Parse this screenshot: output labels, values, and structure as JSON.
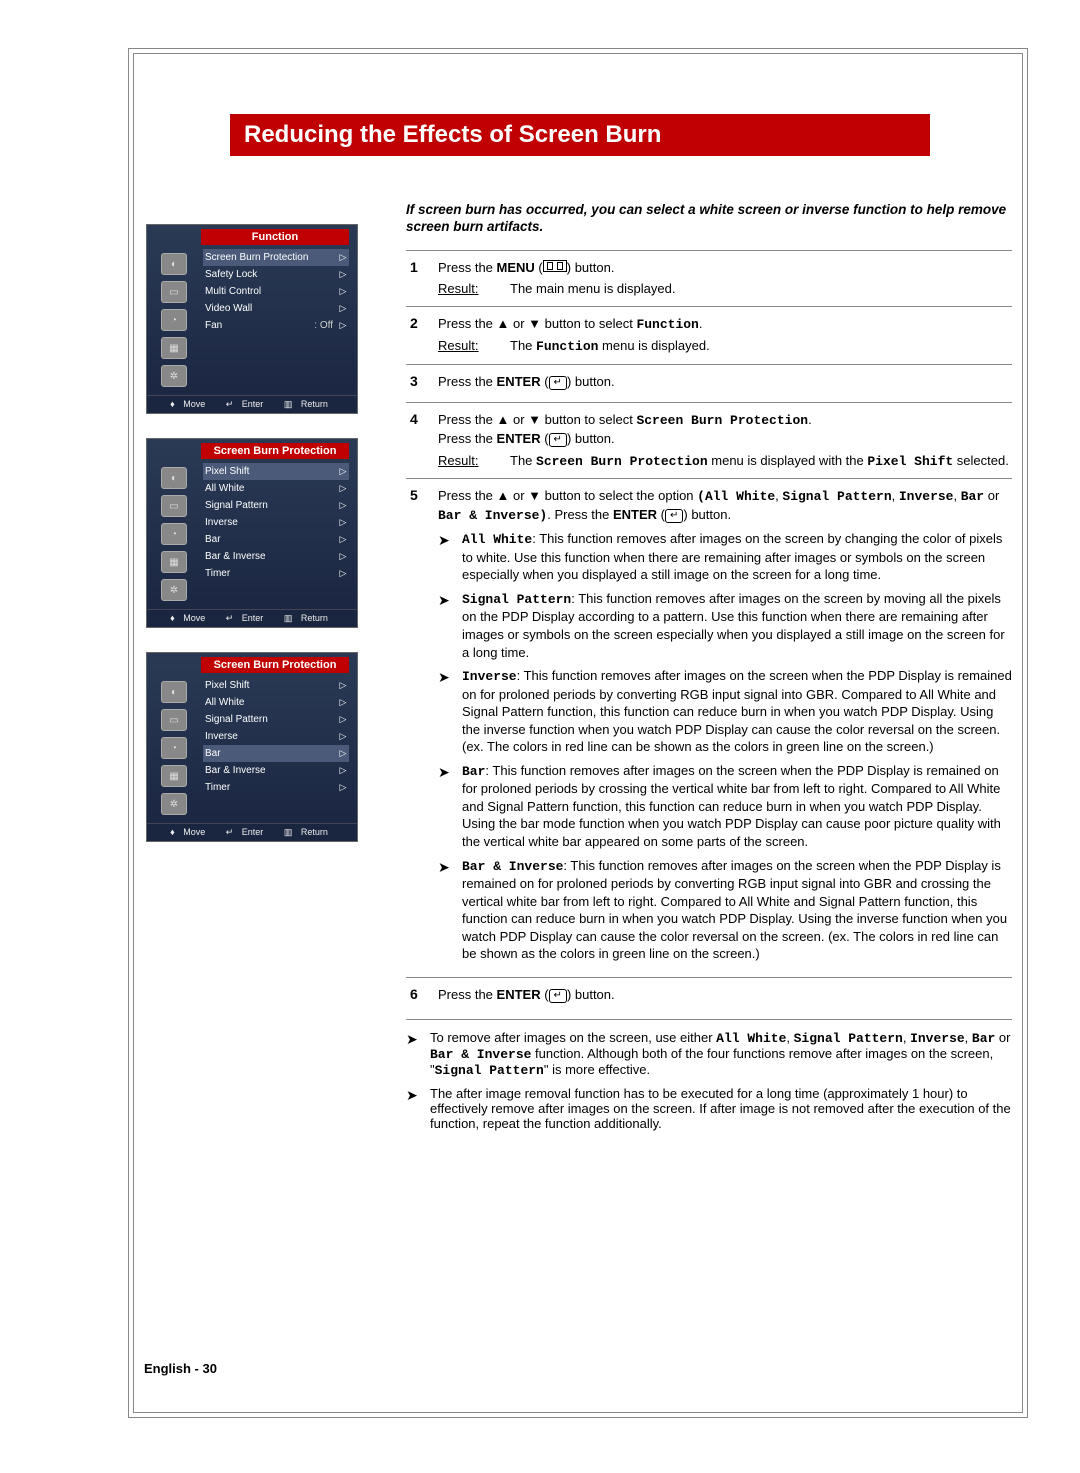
{
  "title": "Reducing the Effects of Screen Burn",
  "intro": "If screen burn has occurred, you can select a white screen or inverse function to help remove screen burn artifacts.",
  "page_label": "English - 30",
  "osd_footer": {
    "move": "Move",
    "enter": "Enter",
    "return": "Return"
  },
  "osd1": {
    "header": "Function",
    "rows": [
      {
        "label": "Screen Burn Protection",
        "value": "",
        "hl": true
      },
      {
        "label": "Safety Lock",
        "value": ""
      },
      {
        "label": "Multi Control",
        "value": ""
      },
      {
        "label": "Video Wall",
        "value": ""
      },
      {
        "label": "Fan",
        "value": ": Off"
      }
    ]
  },
  "osd2": {
    "header": "Screen Burn Protection",
    "rows": [
      {
        "label": "Pixel Shift",
        "hl": true
      },
      {
        "label": "All White"
      },
      {
        "label": "Signal Pattern"
      },
      {
        "label": "Inverse"
      },
      {
        "label": "Bar"
      },
      {
        "label": "Bar & Inverse"
      },
      {
        "label": "Timer"
      }
    ]
  },
  "osd3": {
    "header": "Screen Burn Protection",
    "rows": [
      {
        "label": "Pixel Shift"
      },
      {
        "label": "All White"
      },
      {
        "label": "Signal Pattern"
      },
      {
        "label": "Inverse"
      },
      {
        "label": "Bar",
        "hl": true
      },
      {
        "label": "Bar & Inverse"
      },
      {
        "label": "Timer"
      }
    ]
  },
  "steps": {
    "s1": {
      "l1a": "Press the ",
      "l1b": "MENU",
      "l1c": " (",
      "l1d": ") button.",
      "r": "Result",
      "rtext": "The main menu is displayed."
    },
    "s2": {
      "l1a": "Press the ▲ or ▼ button to select ",
      "l1b": "Function",
      "l1c": ".",
      "r": "Result",
      "rtext_a": "The ",
      "rtext_b": "Function",
      "rtext_c": " menu is displayed."
    },
    "s3": {
      "l1a": "Press the ",
      "l1b": "ENTER",
      "l1c": " (",
      "l1d": ") button."
    },
    "s4": {
      "l1a": "Press the ▲ or ▼ button to select ",
      "l1b": "Screen Burn Protection",
      "l1c": ".",
      "l2a": "Press the ",
      "l2b": "ENTER",
      "l2c": " (",
      "l2d": ") button.",
      "r": "Result",
      "rtext_a": "The ",
      "rtext_b": "Screen Burn Protection",
      "rtext_c": " menu is displayed with the ",
      "rtext_d": "Pixel Shift",
      "rtext_e": " selected."
    },
    "s5": {
      "l1a": "Press the ▲ or ▼ button to select the option ",
      "l1b": "(All White",
      "l1c": ", ",
      "l1d": "Signal Pattern",
      "l1e": ", ",
      "l1f": "Inverse",
      "l1g": ", ",
      "l1h": "Bar",
      "l1i": " or ",
      "l1j": "Bar & Inverse)",
      "l1k": ". Press the ",
      "l1l": "ENTER",
      "l1m": " (",
      "l1n": ") button.",
      "b1_t": "All White",
      "b1": ": This function removes after images on the screen by changing the color of pixels to white. Use this function when there are remaining after images or symbols on the screen especially when you displayed a still image on the screen for a long time.",
      "b2_t": "Signal Pattern",
      "b2": ": This function removes after images on the screen by moving all the pixels on the PDP Display according to a pattern. Use this function when there are remaining after images or symbols on the screen especially when you displayed a still image on the screen for a long time.",
      "b3_t": "Inverse",
      "b3": ": This function removes after images on the screen when the PDP Display is remained on for proloned periods by converting RGB input signal into GBR. Compared to All White and Signal Pattern function, this function can reduce burn in when you watch PDP Display. Using the inverse function when you watch PDP Display can cause the color reversal on the screen. (ex. The colors in red line can be shown as the colors in green line on the screen.)",
      "b4_t": "Bar",
      "b4": ": This function removes after images on the screen when the PDP Display is remained on for proloned periods by crossing the vertical white bar from left to right. Compared to All White and Signal Pattern function, this function can reduce burn in when you watch PDP Display. Using the bar mode function when you watch PDP Display can cause poor picture quality  with the vertical white bar appeared on some parts of the screen.",
      "b5_t": "Bar & Inverse",
      "b5": ": This function removes after images on the screen when the PDP Display is remained on for proloned periods by converting RGB input signal into GBR and crossing the vertical white bar from left to right. Compared to All White and Signal Pattern function, this function can reduce burn in when you watch PDP Display. Using the inverse function when you watch PDP Display can cause the color reversal on the screen. (ex. The colors in red line can be shown as the colors in green line on the screen.)"
    },
    "s6": {
      "l1a": "Press the ",
      "l1b": "ENTER",
      "l1c": " (",
      "l1d": ") button."
    }
  },
  "notes": {
    "n1_a": "To remove after images on the screen, use either ",
    "n1_b": "All White",
    "n1_c": ", ",
    "n1_d": "Signal Pattern",
    "n1_e": ", ",
    "n1_f": "Inverse",
    "n1_g": ", ",
    "n1_h": "Bar",
    "n1_i": " or ",
    "n1_j": "Bar & Inverse",
    "n1_k": "  function. Although both of the four functions remove after images on the screen, \"",
    "n1_l": "Signal Pattern",
    "n1_m": "\" is more effective.",
    "n2": "The after image removal function has to be executed for a long time (approximately 1 hour) to effectively remove after images on the screen. If after image is not removed after the execution of the function, repeat the function additionally."
  }
}
